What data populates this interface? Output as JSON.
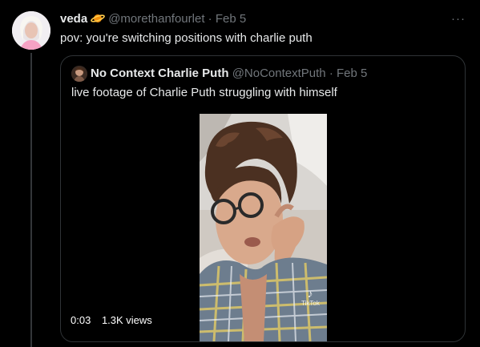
{
  "tweet": {
    "display_name": "veda",
    "handle": "@morethanfourlet",
    "separator": "·",
    "date": "Feb 5",
    "text": "pov: you're switching positions with charlie puth",
    "more_label": "···"
  },
  "quoted": {
    "display_name": "No Context Charlie Puth",
    "handle": "@NoContextPuth",
    "separator": "·",
    "date": "Feb 5",
    "text": "live footage of Charlie Puth struggling with himself",
    "video": {
      "watermark": "TikTok",
      "time": "0:03",
      "views": "1.3K views"
    }
  },
  "colors": {
    "background": "#000000",
    "text": "#e7e9ea",
    "muted": "#71767b",
    "border": "#2f3336"
  }
}
